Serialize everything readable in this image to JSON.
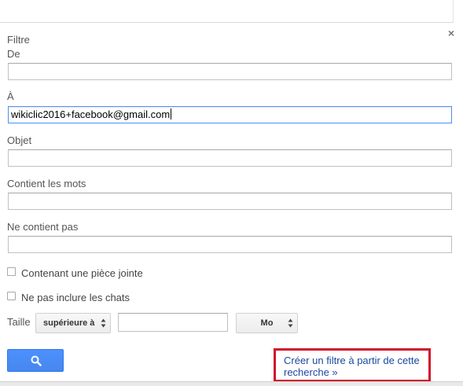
{
  "dialog": {
    "title": "Filtre",
    "close_symbol": "×"
  },
  "fields": {
    "from_label": "De",
    "from_value": "",
    "to_label": "À",
    "to_value": "wikiclic2016+facebook@gmail.com",
    "subject_label": "Objet",
    "subject_value": "",
    "has_words_label": "Contient les mots",
    "has_words_value": "",
    "doesnt_have_label": "Ne contient pas",
    "doesnt_have_value": ""
  },
  "options": {
    "has_attachment_label": "Contenant une pièce jointe",
    "has_attachment_checked": false,
    "exclude_chats_label": "Ne pas inclure les chats",
    "exclude_chats_checked": false
  },
  "size": {
    "label": "Taille",
    "comparison_selected": "supérieure à",
    "value": "",
    "unit_selected": "Mo"
  },
  "actions": {
    "search_icon": "search-icon",
    "create_filter_link": "Créer un filtre à partir de cette recherche »"
  },
  "colors": {
    "primary_button": "#4d90fe",
    "link": "#1a4aa0",
    "highlight_box": "#d0142c",
    "focus_border": "#4d90fe"
  }
}
